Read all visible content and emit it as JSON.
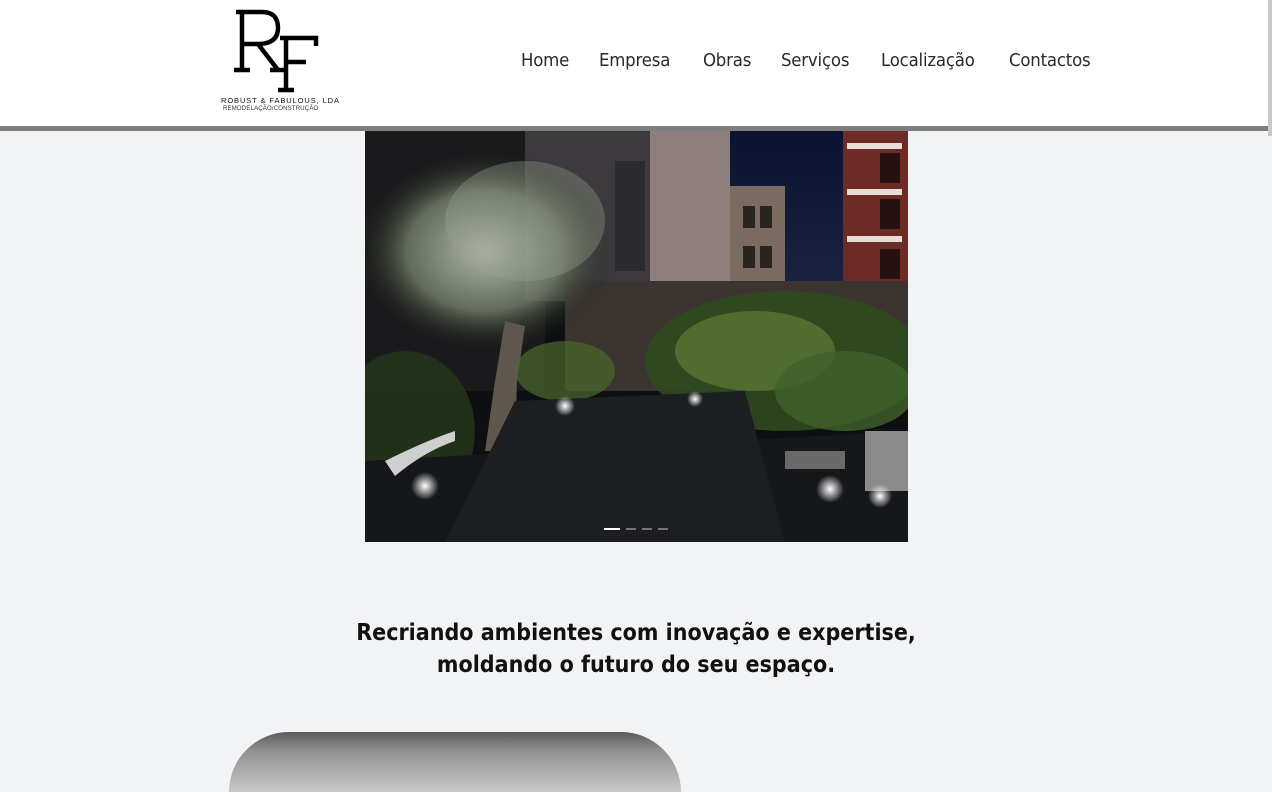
{
  "brand": {
    "monogram": "RF",
    "name": "ROBUST & FABULOUS, LDA",
    "tagline": "REMODELAÇÃO/CONSTRUÇÃO"
  },
  "nav": {
    "items": [
      {
        "label": "Home"
      },
      {
        "label": "Empresa"
      },
      {
        "label": "Obras"
      },
      {
        "label": "Serviços"
      },
      {
        "label": "Localização"
      },
      {
        "label": "Contactos"
      }
    ]
  },
  "carousel": {
    "slide_count": 4,
    "active_index": 0
  },
  "headline": {
    "line1": "Recriando ambientes com inovação e expertise,",
    "line2": "moldando o futuro do seu espaço."
  },
  "colors": {
    "background": "#f2f3f5",
    "header_border": "#7d7d7d",
    "text": "#111111"
  }
}
